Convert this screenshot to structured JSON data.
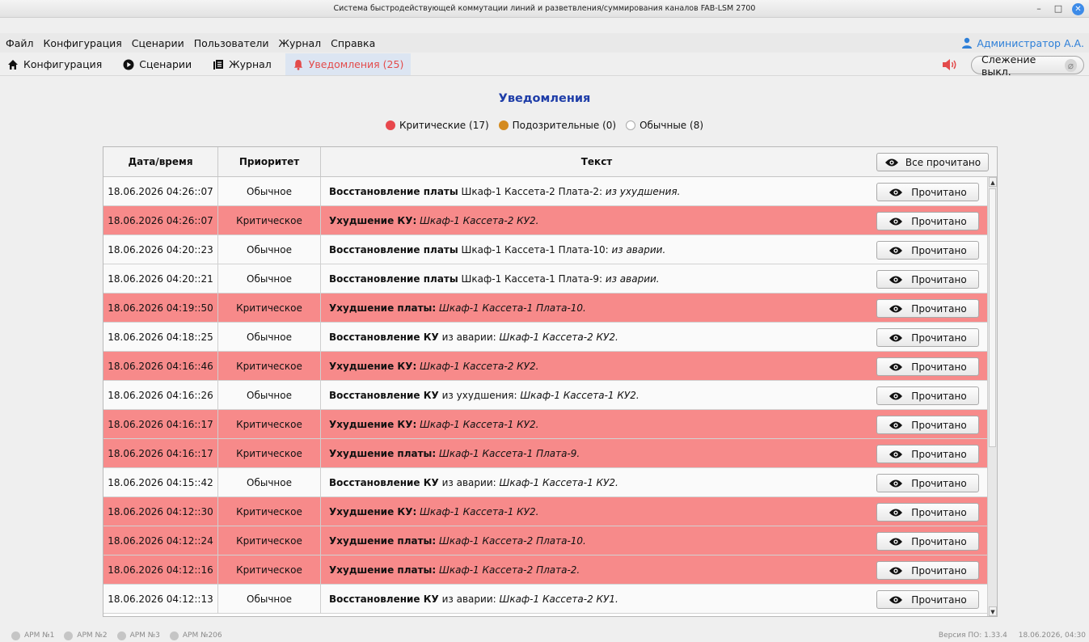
{
  "window": {
    "title": "Система быстродействующей коммутации линий и разветвления/суммирования каналов FAB-LSM 2700",
    "minimize": "–",
    "maximize": "□",
    "close": "✕"
  },
  "menu": {
    "items": [
      "Файл",
      "Конфигурация",
      "Сценарии",
      "Пользователи",
      "Журнал",
      "Справка"
    ],
    "user": "Администратор А.А."
  },
  "tabs": {
    "items": [
      {
        "label": "Конфигурация",
        "icon": "home-icon"
      },
      {
        "label": "Сценарии",
        "icon": "play-icon"
      },
      {
        "label": "Журнал",
        "icon": "journal-icon"
      },
      {
        "label": "Уведомления (25)",
        "icon": "bell-icon"
      }
    ],
    "active_color": "#e34b4b",
    "follow": "Слежение выкл."
  },
  "page": {
    "title": "Уведомления",
    "filters": [
      {
        "label": "Критические (17)",
        "color": "#e8484d"
      },
      {
        "label": "Подозрительные (0)",
        "color": "#d48a1e"
      },
      {
        "label": "Обычные (8)",
        "color": "#ffffff"
      }
    ]
  },
  "table": {
    "headers": {
      "datetime": "Дата/время",
      "priority": "Приоритет",
      "text": "Текст"
    },
    "all_read": "Все прочитано",
    "read_label": "Прочитано",
    "critical_color": "#f78a8a",
    "rows": [
      {
        "dt": "18.06.2026 04:26::07",
        "prio": "Обычное",
        "crit": false,
        "b": "Восстановление платы",
        "n": " Шкаф-1 Кассета-2 Плата-2: ",
        "i": "из ухудшения."
      },
      {
        "dt": "18.06.2026 04:26::07",
        "prio": "Критическое",
        "crit": true,
        "b": "Ухудшение КУ:",
        "n": " ",
        "i": "Шкаф-1 Кассета-2 КУ2."
      },
      {
        "dt": "18.06.2026 04:20::23",
        "prio": "Обычное",
        "crit": false,
        "b": "Восстановление платы",
        "n": " Шкаф-1 Кассета-1 Плата-10: ",
        "i": "из аварии."
      },
      {
        "dt": "18.06.2026 04:20::21",
        "prio": "Обычное",
        "crit": false,
        "b": "Восстановление платы",
        "n": " Шкаф-1 Кассета-1 Плата-9: ",
        "i": "из аварии."
      },
      {
        "dt": "18.06.2026 04:19::50",
        "prio": "Критическое",
        "crit": true,
        "b": "Ухудшение платы:",
        "n": " ",
        "i": "Шкаф-1 Кассета-1 Плата-10."
      },
      {
        "dt": "18.06.2026 04:18::25",
        "prio": "Обычное",
        "crit": false,
        "b": "Восстановление КУ",
        "n": " из аварии: ",
        "i": "Шкаф-1 Кассета-2 КУ2."
      },
      {
        "dt": "18.06.2026 04:16::46",
        "prio": "Критическое",
        "crit": true,
        "b": "Ухудшение КУ:",
        "n": " ",
        "i": "Шкаф-1 Кассета-2 КУ2."
      },
      {
        "dt": "18.06.2026 04:16::26",
        "prio": "Обычное",
        "crit": false,
        "b": "Восстановление КУ",
        "n": " из ухудшения: ",
        "i": "Шкаф-1 Кассета-1 КУ2."
      },
      {
        "dt": "18.06.2026 04:16::17",
        "prio": "Критическое",
        "crit": true,
        "b": "Ухудшение КУ:",
        "n": " ",
        "i": "Шкаф-1 Кассета-1 КУ2."
      },
      {
        "dt": "18.06.2026 04:16::17",
        "prio": "Критическое",
        "crit": true,
        "b": "Ухудшение платы:",
        "n": " ",
        "i": "Шкаф-1 Кассета-1 Плата-9."
      },
      {
        "dt": "18.06.2026 04:15::42",
        "prio": "Обычное",
        "crit": false,
        "b": "Восстановление КУ",
        "n": " из аварии: ",
        "i": "Шкаф-1 Кассета-1 КУ2."
      },
      {
        "dt": "18.06.2026 04:12::30",
        "prio": "Критическое",
        "crit": true,
        "b": "Ухудшение КУ:",
        "n": " ",
        "i": "Шкаф-1 Кассета-1 КУ2."
      },
      {
        "dt": "18.06.2026 04:12::24",
        "prio": "Критическое",
        "crit": true,
        "b": "Ухудшение платы:",
        "n": " ",
        "i": "Шкаф-1 Кассета-2 Плата-10."
      },
      {
        "dt": "18.06.2026 04:12::16",
        "prio": "Критическое",
        "crit": true,
        "b": "Ухудшение платы:",
        "n": " ",
        "i": "Шкаф-1 Кассета-2 Плата-2."
      },
      {
        "dt": "18.06.2026 04:12::13",
        "prio": "Обычное",
        "crit": false,
        "b": "Восстановление КУ",
        "n": " из аварии: ",
        "i": "Шкаф-1 Кассета-2 КУ1."
      }
    ]
  },
  "status": {
    "arms": [
      "АРМ №1",
      "АРМ №2",
      "АРМ №3",
      "АРМ №206"
    ],
    "version": "Версия ПО: 1.33.4",
    "datetime": "18.06.2026, 04:30"
  }
}
